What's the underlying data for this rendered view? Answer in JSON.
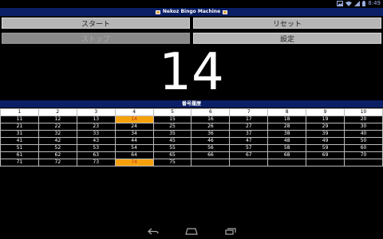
{
  "status_bar": {
    "clock": "8:49",
    "icons": [
      "gallery-icon",
      "wifi-icon",
      "signal-icon",
      "battery-icon"
    ]
  },
  "app": {
    "title": "Nekoz Bingo Machine"
  },
  "controls": {
    "start_label": "スタート",
    "reset_label": "リセット",
    "stop_label": "ストップ",
    "settings_label": "設定"
  },
  "current_number": "14",
  "history": {
    "title": "番号履歴",
    "columns": [
      "1",
      "2",
      "3",
      "4",
      "5",
      "6",
      "7",
      "8",
      "9",
      "10"
    ],
    "rows": [
      [
        "11",
        "12",
        "13",
        "14",
        "15",
        "16",
        "17",
        "18",
        "19",
        "20"
      ],
      [
        "21",
        "22",
        "23",
        "24",
        "25",
        "26",
        "27",
        "28",
        "29",
        "30"
      ],
      [
        "31",
        "32",
        "33",
        "34",
        "35",
        "36",
        "37",
        "38",
        "39",
        "40"
      ],
      [
        "41",
        "42",
        "43",
        "44",
        "45",
        "46",
        "47",
        "48",
        "49",
        "50"
      ],
      [
        "51",
        "52",
        "53",
        "54",
        "55",
        "56",
        "57",
        "58",
        "59",
        "60"
      ],
      [
        "61",
        "62",
        "63",
        "64",
        "65",
        "66",
        "67",
        "68",
        "69",
        "70"
      ],
      [
        "71",
        "72",
        "73",
        "74",
        "75",
        "",
        "",
        "",
        "",
        ""
      ]
    ],
    "called": [
      "14",
      "74"
    ],
    "highlight_color": "#f5a10d"
  },
  "colors": {
    "title_bar": "#0b1f66",
    "button_bg": "#b5b5b5"
  },
  "nav_bar": {
    "icons": [
      "back-icon",
      "home-icon",
      "recents-icon"
    ]
  }
}
